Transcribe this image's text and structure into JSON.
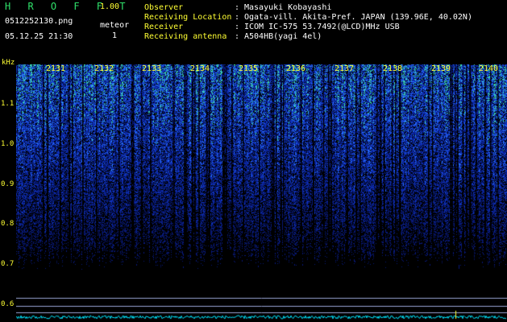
{
  "header": {
    "app_title": "H R O F F T",
    "app_version": "1.00",
    "file_name": "0512252130.png",
    "meteor_label": "meteor",
    "meteor_count": "1",
    "date_time": "05.12.25 21:30"
  },
  "info": [
    {
      "label": "Observer",
      "sep": ":",
      "value": "Masayuki Kobayashi"
    },
    {
      "label": "Receiving Location",
      "sep": ":",
      "value": "Ogata-vill. Akita-Pref. JAPAN (139.96E, 40.02N)"
    },
    {
      "label": "Receiver",
      "sep": ":",
      "value": "ICOM IC-575 53.7492(@LCD)MHz USB"
    },
    {
      "label": "Receiving antenna",
      "sep": ":",
      "value": "A504HB(yagi 4el)"
    }
  ],
  "plot": {
    "y_unit": "kHz",
    "y_ticks": [
      "1.1",
      "1.0",
      "0.9",
      "0.8",
      "0.7",
      "0.6"
    ],
    "x_ticks": [
      "2131",
      "2132",
      "2133",
      "2134",
      "2135",
      "2136",
      "2137",
      "2138",
      "2139",
      "2140"
    ],
    "colors": {
      "background": "#000000",
      "signal_low": "#0a1e8c",
      "signal_mid": "#2e6cff",
      "signal_high": "#3ce0a0",
      "baseline": "#00e5ff",
      "labels": "#ffff33",
      "header_title": "#2fe06a"
    }
  }
}
